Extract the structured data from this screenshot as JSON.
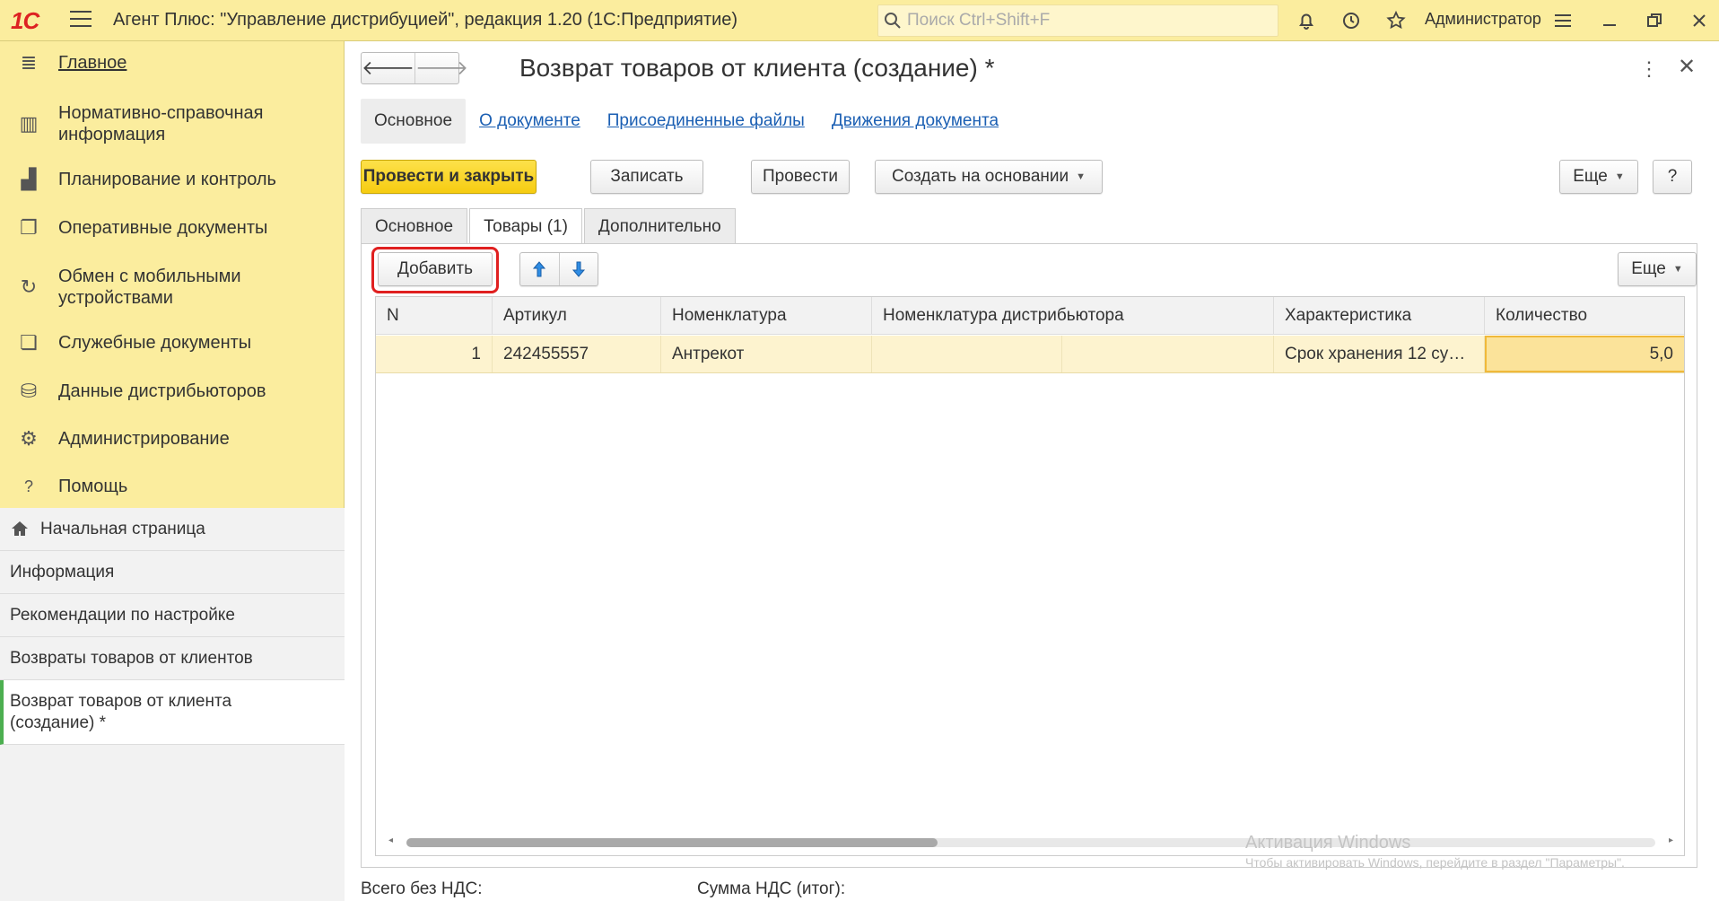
{
  "topbar": {
    "logo": "1С",
    "title": "Агент Плюс: \"Управление дистрибуцией\", редакция 1.20  (1С:Предприятие)",
    "search_placeholder": "Поиск Ctrl+Shift+F",
    "user": "Администратор"
  },
  "sidebar": {
    "sections": [
      {
        "label": "Главное",
        "icon": "menu-icon"
      },
      {
        "label": "Нормативно-справочная информация",
        "icon": "reference-icon"
      },
      {
        "label": "Планирование и контроль",
        "icon": "chart-icon"
      },
      {
        "label": "Оперативные документы",
        "icon": "documents-icon"
      },
      {
        "label": "Обмен с мобильными устройствами",
        "icon": "sync-icon"
      },
      {
        "label": "Служебные документы",
        "icon": "service-docs-icon"
      },
      {
        "label": "Данные дистрибьюторов",
        "icon": "distributors-icon"
      },
      {
        "label": "Администрирование",
        "icon": "gear-icon"
      },
      {
        "label": "Помощь",
        "icon": "help-icon"
      }
    ],
    "open_windows": [
      {
        "label": "Начальная страница",
        "icon": "home-icon"
      },
      {
        "label": "Информация"
      },
      {
        "label": "Рекомендации по настройке"
      },
      {
        "label": "Возвраты товаров от клиентов"
      },
      {
        "label": "Возврат товаров от клиента (создание) *"
      }
    ]
  },
  "document": {
    "title": "Возврат товаров от клиента (создание) *",
    "nav_tabs": [
      "Основное",
      "О документе",
      "Присоединенные файлы",
      "Движения документа"
    ],
    "toolbar": {
      "post_close": "Провести и закрыть",
      "save": "Записать",
      "post": "Провести",
      "create_based": "Создать на основании",
      "more": "Еще",
      "help": "?"
    },
    "form_tabs": [
      "Основное",
      "Товары (1)",
      "Дополнительно"
    ],
    "table_toolbar": {
      "add": "Добавить",
      "more": "Еще"
    },
    "table": {
      "columns": [
        "N",
        "Артикул",
        "Номенклатура",
        "Номенклатура дистрибьютора",
        "Характеристика",
        "Количество"
      ],
      "rows": [
        {
          "n": "1",
          "article": "242455557",
          "item": "Антрекот",
          "dist_item": "",
          "characteristic": "Срок хранения 12 су…",
          "qty": "5,0"
        }
      ]
    },
    "footer": {
      "total_no_vat": "Всего без НДС:",
      "vat_sum": "Сумма НДС (итог):"
    }
  },
  "watermark": {
    "line1": "Активация Windows",
    "line2": "Чтобы активировать Windows, перейдите в раздел \"Параметры\"."
  },
  "colors": {
    "accent_yellow": "#fbed9e",
    "primary_button": "#f6cc11",
    "highlight_red": "#e02020",
    "link_blue": "#1b5fb3"
  }
}
